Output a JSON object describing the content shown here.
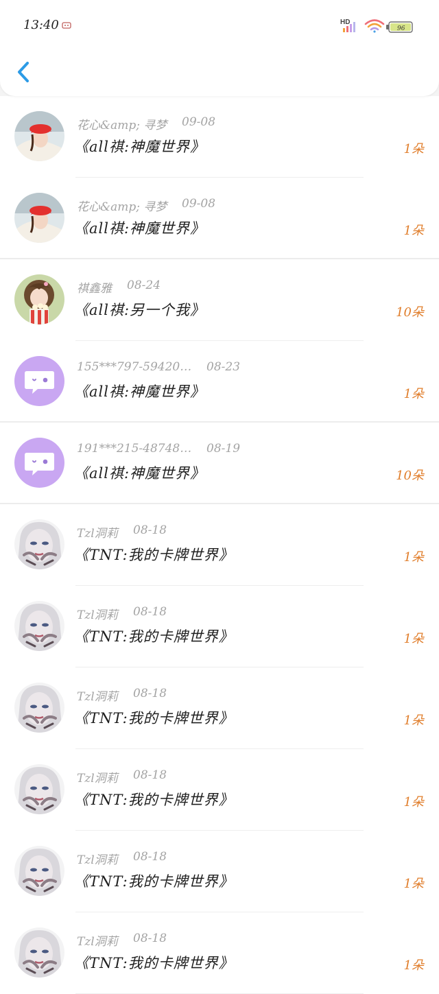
{
  "status_bar": {
    "time": "13:40",
    "hd_label": "HD",
    "battery_color": "#d8e58a"
  },
  "header": {
    "back_icon": "chevron-left-icon",
    "accent": "#2c9be6"
  },
  "colors": {
    "count": "#e07d2a",
    "meta": "#a4a4a4"
  },
  "items": [
    {
      "user": "花心&amp; 寻梦",
      "date": "09-08",
      "title": "《all祺:神魔世界》",
      "count": "1朵",
      "avatar": "red-hat-girl"
    },
    {
      "user": "花心&amp; 寻梦",
      "date": "09-08",
      "title": "《all祺:神魔世界》",
      "count": "1朵",
      "avatar": "red-hat-girl"
    },
    {
      "user": "祺鑫雅",
      "date": "08-24",
      "title": "《all祺:另一个我》",
      "count": "10朵",
      "avatar": "popcorn-girl"
    },
    {
      "user": "155***797-59420…",
      "date": "08-23",
      "title": "《all祺:神魔世界》",
      "count": "1朵",
      "avatar": "chat-bubble"
    },
    {
      "user": "191***215-48748…",
      "date": "08-19",
      "title": "《all祺:神魔世界》",
      "count": "10朵",
      "avatar": "chat-bubble"
    },
    {
      "user": "Tzl洞莉",
      "date": "08-18",
      "title": "《TNT:我的卡牌世界》",
      "count": "1朵",
      "avatar": "pale-face"
    },
    {
      "user": "Tzl洞莉",
      "date": "08-18",
      "title": "《TNT:我的卡牌世界》",
      "count": "1朵",
      "avatar": "pale-face"
    },
    {
      "user": "Tzl洞莉",
      "date": "08-18",
      "title": "《TNT:我的卡牌世界》",
      "count": "1朵",
      "avatar": "pale-face"
    },
    {
      "user": "Tzl洞莉",
      "date": "08-18",
      "title": "《TNT:我的卡牌世界》",
      "count": "1朵",
      "avatar": "pale-face"
    },
    {
      "user": "Tzl洞莉",
      "date": "08-18",
      "title": "《TNT:我的卡牌世界》",
      "count": "1朵",
      "avatar": "pale-face"
    },
    {
      "user": "Tzl洞莉",
      "date": "08-18",
      "title": "《TNT:我的卡牌世界》",
      "count": "1朵",
      "avatar": "pale-face"
    }
  ]
}
